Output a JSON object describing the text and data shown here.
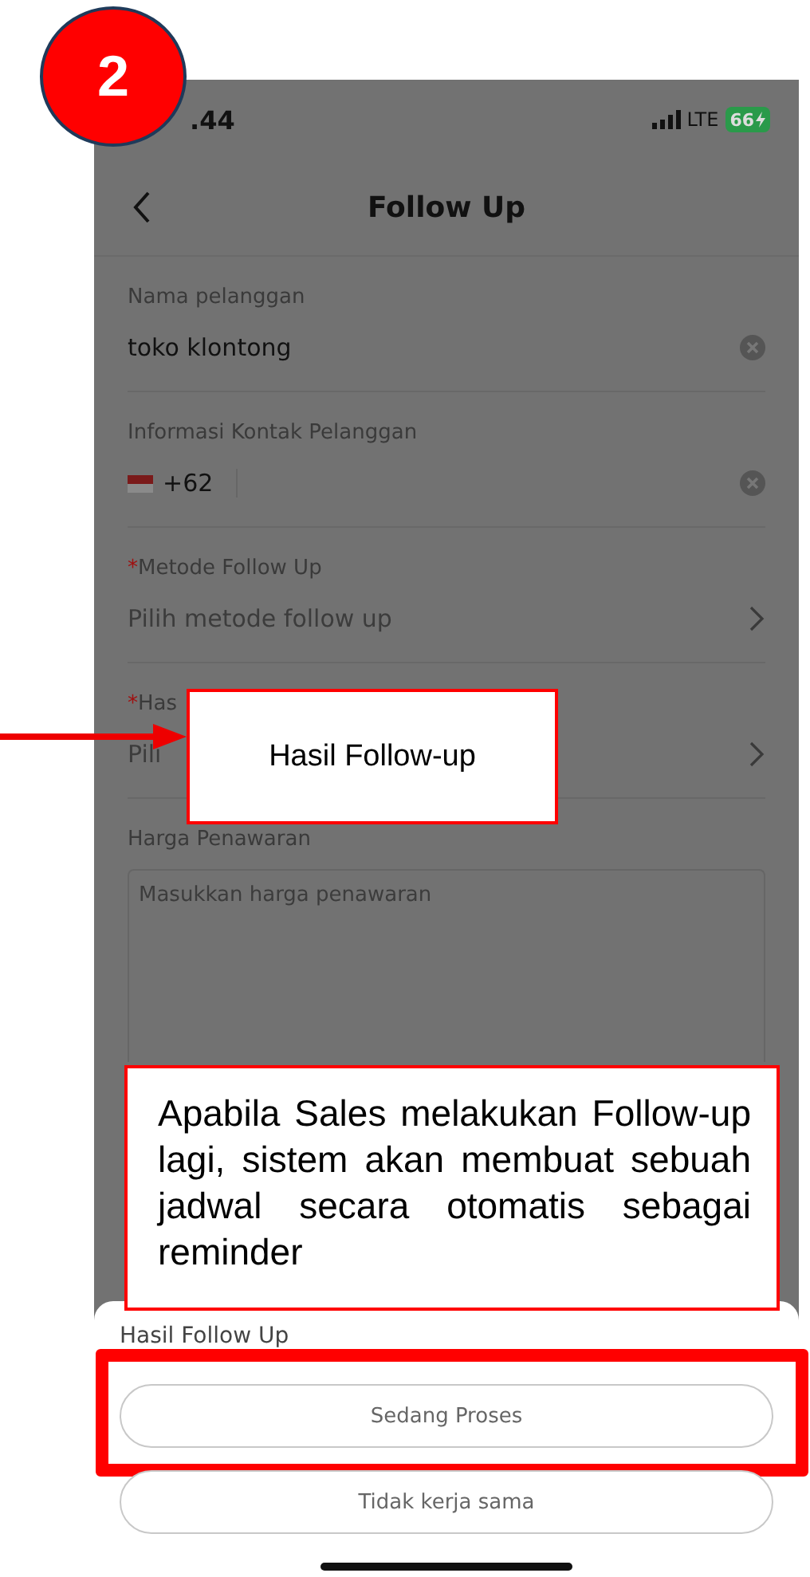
{
  "badge": {
    "number": "2"
  },
  "status_bar": {
    "time": ".44",
    "network": "LTE",
    "battery": "66"
  },
  "nav": {
    "title": "Follow Up"
  },
  "form": [
    {
      "kind": "text",
      "label": "Nama pelanggan",
      "value": "toko klontong"
    },
    {
      "kind": "phone",
      "label": "Informasi Kontak Pelanggan",
      "country_code": "+62"
    },
    {
      "kind": "select",
      "required_mark": "*",
      "label": "Metode Follow Up",
      "placeholder": "Pilih metode follow up"
    },
    {
      "kind": "select",
      "required_mark": "*",
      "label": "Has",
      "placeholder": "Pili"
    },
    {
      "kind": "textarea",
      "label": "Harga Penawaran",
      "placeholder": "Masukkan harga penawaran"
    }
  ],
  "sheet": {
    "title": "Hasil Follow Up",
    "options": [
      {
        "label": "Sedang Proses",
        "highlighted": true
      },
      {
        "label": "Tidak kerja sama",
        "highlighted": false
      }
    ]
  },
  "callouts": [
    {
      "text": "Hasil Follow-up"
    },
    {
      "text": "Apabila Sales melakukan Follow-up lagi, sistem akan membuat sebuah jadwal secara otomatis sebagai reminder"
    }
  ]
}
